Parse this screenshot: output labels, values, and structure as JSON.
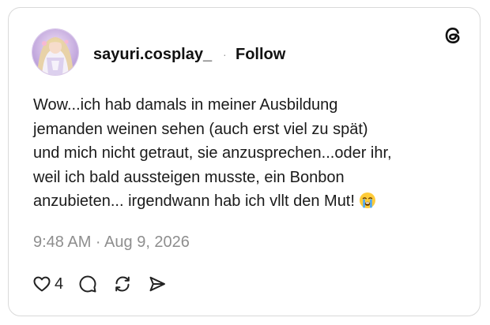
{
  "post": {
    "author": {
      "username": "sayuri.cosplay_",
      "avatar_icon": "avatar-icon"
    },
    "separator": "·",
    "follow_label": "Follow",
    "app_logo": "threads-logo-icon",
    "body_lines": [
      "Wow...ich hab damals in meiner Ausbildung",
      "jemanden weinen sehen (auch erst viel zu spät)",
      "und mich nicht getraut, sie anzusprechen...oder ihr,",
      "weil ich bald aussteigen musste, ein Bonbon",
      "anzubieten... irgendwann hab ich vllt den Mut!"
    ],
    "body_emoji": "loudly-crying-face-icon",
    "timestamp": "9:48 AM · Aug 9, 2026",
    "actions": {
      "like_icon": "heart-icon",
      "like_count": "4",
      "reply_icon": "comment-icon",
      "repost_icon": "repost-icon",
      "share_icon": "send-icon"
    }
  },
  "colors": {
    "text": "#111111",
    "muted": "#8e8e8e",
    "border": "#d9d9d9",
    "background": "#ffffff"
  }
}
